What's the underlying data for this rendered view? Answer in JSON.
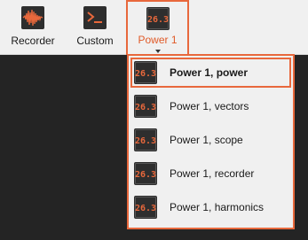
{
  "toolbar": {
    "recorder": {
      "label": "Recorder",
      "icon": "waveform-icon"
    },
    "custom": {
      "label": "Custom",
      "icon": "terminal-prompt-icon"
    },
    "power": {
      "label": "Power 1",
      "icon": "digital-readout-icon",
      "readout": "26.3"
    }
  },
  "menu": {
    "items": [
      {
        "label": "Power 1, power",
        "icon": "digital-readout-icon",
        "readout": "26.3",
        "selected": true
      },
      {
        "label": "Power 1, vectors",
        "icon": "digital-readout-icon",
        "readout": "26.3"
      },
      {
        "label": "Power 1, scope",
        "icon": "digital-readout-icon",
        "readout": "26.3"
      },
      {
        "label": "Power 1, recorder",
        "icon": "digital-readout-icon",
        "readout": "26.3"
      },
      {
        "label": "Power 1, harmonics",
        "icon": "digital-readout-icon",
        "readout": "26.3"
      }
    ]
  },
  "colors": {
    "accent": "#e8683c",
    "accent_text": "#e05a28",
    "icon_bg": "#2e2e2e",
    "toolbar_bg": "#f0f0f0",
    "workspace_bg": "#242424"
  }
}
